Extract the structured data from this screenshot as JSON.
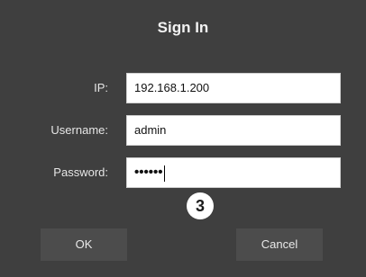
{
  "dialog": {
    "title": "Sign In"
  },
  "fields": {
    "ip": {
      "label": "IP:",
      "value": "192.168.1.200"
    },
    "username": {
      "label": "Username:",
      "value": "admin"
    },
    "password": {
      "label": "Password:",
      "value": "••••••"
    }
  },
  "annotation": {
    "step": "3"
  },
  "buttons": {
    "ok": "OK",
    "cancel": "Cancel"
  }
}
